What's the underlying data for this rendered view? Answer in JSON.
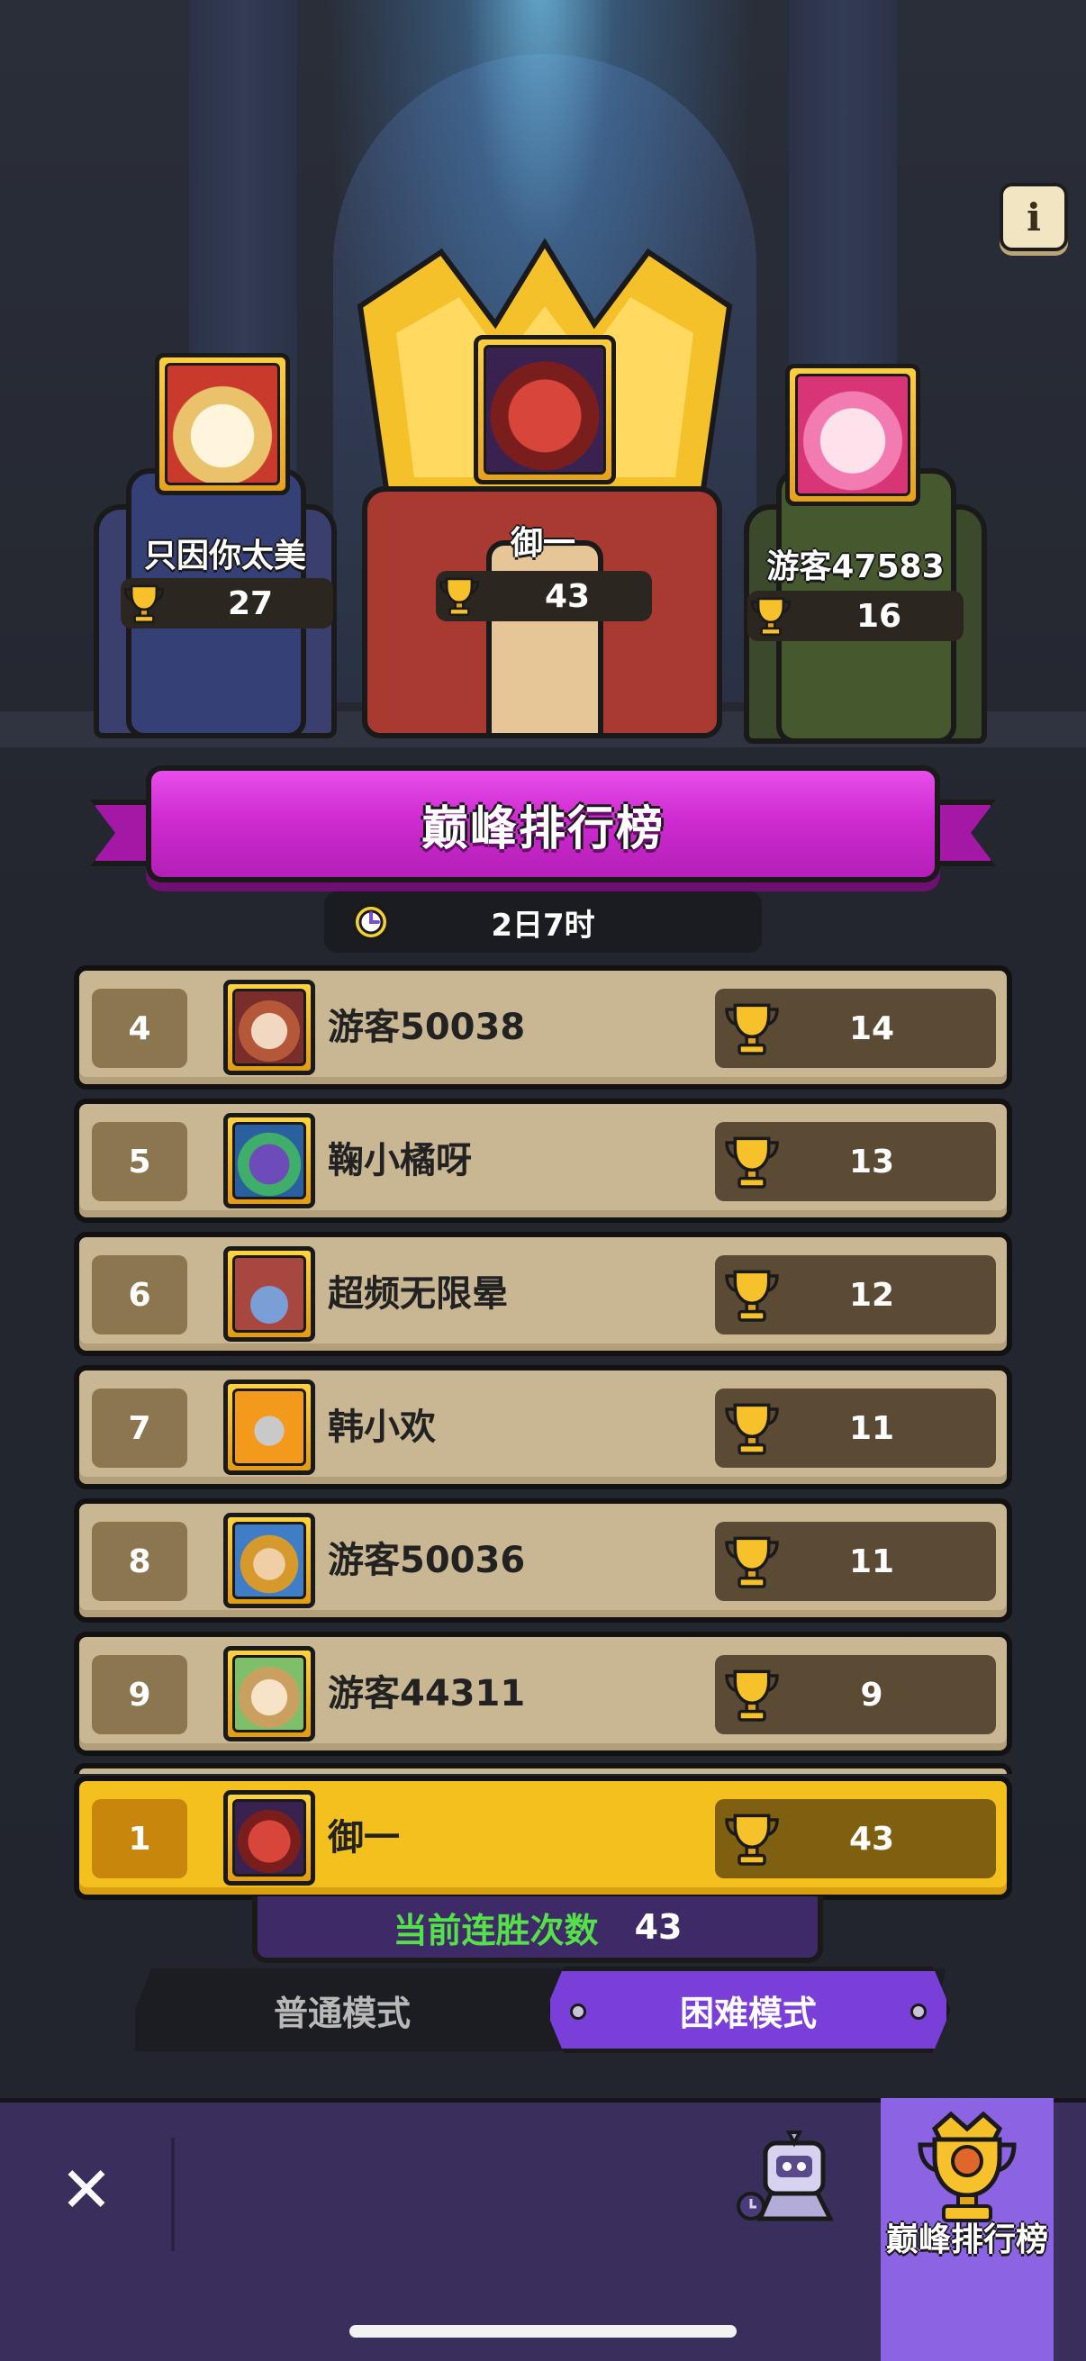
{
  "header": {
    "info_icon": "info-icon"
  },
  "podium": {
    "first": {
      "name": "御一",
      "trophies": "43"
    },
    "second": {
      "name": "只因你太美",
      "trophies": "27"
    },
    "third": {
      "name": "游客47583",
      "trophies": "16"
    }
  },
  "leaderboard": {
    "title": "巅峰排行榜",
    "timer": "2日7时",
    "rows": [
      {
        "rank": "4",
        "name": "游客50038",
        "trophies": "14"
      },
      {
        "rank": "5",
        "name": "鞠小橘呀",
        "trophies": "13"
      },
      {
        "rank": "6",
        "name": "超频无限晕",
        "trophies": "12"
      },
      {
        "rank": "7",
        "name": "韩小欢",
        "trophies": "11"
      },
      {
        "rank": "8",
        "name": "游客50036",
        "trophies": "11"
      },
      {
        "rank": "9",
        "name": "游客44311",
        "trophies": "9"
      }
    ],
    "self": {
      "rank": "1",
      "name": "御一",
      "trophies": "43"
    }
  },
  "streak": {
    "label": "当前连胜次数",
    "value": "43"
  },
  "modes": {
    "normal": "普通模式",
    "hard": "困难模式",
    "selected": "hard"
  },
  "bottom_nav": {
    "close": "✕",
    "active_label": "巅峰排行榜"
  },
  "colors": {
    "accent_magenta": "#cf2bd1",
    "row_bg": "#c9b794",
    "self_row": "#f4c01e",
    "hard_mode": "#7a3fd8",
    "streak_green": "#55e04a"
  }
}
